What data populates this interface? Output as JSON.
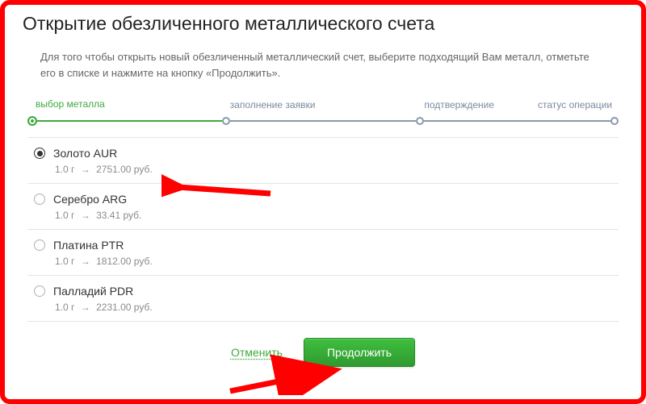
{
  "title": "Открытие обезличенного металлического счета",
  "intro": "Для того чтобы открыть новый обезличенный металлический счет, выберите подходящий Вам металл, отметьте его в списке и нажмите на кнопку «Продолжить».",
  "stepper": {
    "steps": [
      {
        "label": "выбор металла",
        "active": true
      },
      {
        "label": "заполнение заявки",
        "active": false
      },
      {
        "label": "подтверждение",
        "active": false
      },
      {
        "label": "статус операции",
        "active": false
      }
    ]
  },
  "metals": [
    {
      "name": "Золото AUR",
      "unit": "1.0 г",
      "price": "2751.00 руб.",
      "selected": true
    },
    {
      "name": "Серебро ARG",
      "unit": "1.0 г",
      "price": "33.41 руб.",
      "selected": false
    },
    {
      "name": "Платина PTR",
      "unit": "1.0 г",
      "price": "1812.00 руб.",
      "selected": false
    },
    {
      "name": "Палладий PDR",
      "unit": "1.0 г",
      "price": "2231.00 руб.",
      "selected": false
    }
  ],
  "actions": {
    "cancel": "Отменить",
    "continue": "Продолжить"
  }
}
